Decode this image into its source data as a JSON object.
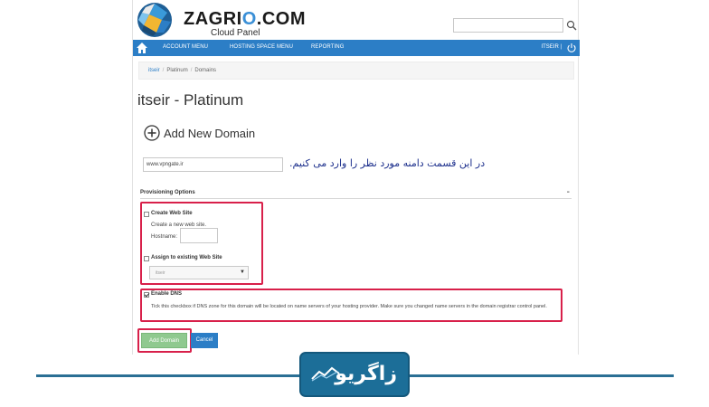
{
  "header": {
    "logo_main_a": "ZAGRI",
    "logo_main_b": "O",
    "logo_main_c": ".COM",
    "logo_sub": "Cloud Panel",
    "search_placeholder": ""
  },
  "nav": {
    "items": [
      "ACCOUNT MENU",
      "HOSTING SPACE MENU",
      "REPORTING"
    ],
    "user": "ITSEIR |"
  },
  "breadcrumb": {
    "items": [
      "itseir",
      "Platinum",
      "Domains"
    ]
  },
  "page_title": "itseir - Platinum",
  "add_domain_label": "Add New Domain",
  "domain_input_value": "www.vpngate.ir",
  "annotation_text": "در این قسمت دامنه مورد نظر را وارد می کنیم.",
  "provisioning": {
    "title": "Provisioning Options",
    "toggle": "-",
    "create_web_site": {
      "label": "Create Web Site",
      "checked": false,
      "desc": "Create a new web site.",
      "hostname_label": "Hostname:",
      "hostname_value": ""
    },
    "assign_web_site": {
      "label": "Assign to existing Web Site",
      "checked": false,
      "select_value": "itseir"
    },
    "enable_dns": {
      "label": "Enable DNS",
      "checked": true,
      "desc": "Tick this checkbox if DNS zone for this domain will be located on name servers of your hosting provider. Make sure you changed name servers in the domain registrar control panel."
    }
  },
  "buttons": {
    "add": "Add Domain",
    "cancel": "Cancel"
  },
  "watermark": {
    "text": "زاگریو"
  },
  "colors": {
    "nav_blue": "#2c7ec6",
    "highlight_red": "#d8204a",
    "badge_blue": "#1c6e98",
    "add_button_green": "#8fc98f"
  }
}
